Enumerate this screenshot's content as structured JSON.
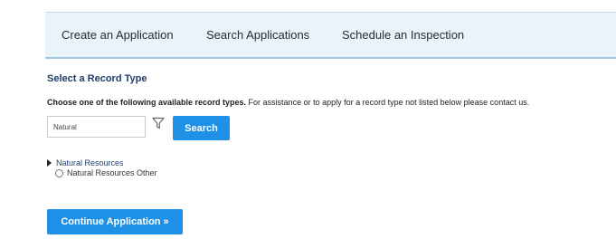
{
  "nav": {
    "tabs": [
      {
        "label": "Create an Application"
      },
      {
        "label": "Search Applications"
      },
      {
        "label": "Schedule an Inspection"
      }
    ]
  },
  "record_type": {
    "section_title": "Select a Record Type",
    "instructions_bold": "Choose one of the following available record types.",
    "instructions_rest": " For assistance or to apply for a record type not listed below please contact us."
  },
  "search": {
    "value": "Natural",
    "button_label": "Search",
    "filter_icon": "filter-icon"
  },
  "groups": [
    {
      "title": "Natural Resources",
      "expanded": true,
      "options": [
        {
          "label": "Natural Resources Other",
          "selected": false
        }
      ]
    }
  ],
  "actions": {
    "continue_label": "Continue Application »"
  },
  "colors": {
    "accent": "#1e90e6",
    "tabbar_bg": "#e9f3fa",
    "heading": "#1f3d6b"
  }
}
